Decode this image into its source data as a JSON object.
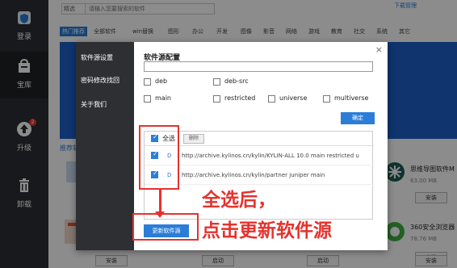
{
  "sidebar": {
    "items": [
      {
        "label": "登录",
        "icon": "shield-icon"
      },
      {
        "label": "宝库",
        "icon": "store-icon"
      },
      {
        "label": "升级",
        "icon": "upgrade-icon",
        "badge": "2"
      },
      {
        "label": "卸载",
        "icon": "trash-icon"
      }
    ]
  },
  "topbar": {
    "select_value": "精选",
    "search_placeholder": "请输入您要搜索的软件",
    "download_manager": "下载管理"
  },
  "categories": [
    "热门推荐",
    "全部软件",
    "win替换",
    "图形",
    "办公",
    "开发",
    "图像",
    "影音",
    "网络",
    "游戏",
    "教育",
    "社交",
    "系统",
    "其它"
  ],
  "background": {
    "recommend_title": "推荐软",
    "apps": [
      {
        "name": "思维导图软件M",
        "size": "63.00 MB",
        "button": "安装"
      },
      {
        "name": "360安全浏览器",
        "size": "78.76 MB",
        "button": "安装"
      }
    ],
    "bottom_buttons": [
      "安装",
      "启动",
      "启动",
      "安装"
    ]
  },
  "dialog": {
    "nav": [
      "软件源设置",
      "密码修改找回",
      "关于我们"
    ],
    "title": "软件源配置",
    "close": "×",
    "options": [
      {
        "label": "deb",
        "checked": false
      },
      {
        "label": "deb-src",
        "checked": false
      },
      {
        "label": "main",
        "checked": false
      },
      {
        "label": "restricted",
        "checked": false
      },
      {
        "label": "universe",
        "checked": false
      },
      {
        "label": "multiverse",
        "checked": false
      }
    ],
    "confirm": "确定",
    "select_all": "全选",
    "delete": "删除",
    "sources": [
      {
        "flag": "D",
        "url": "http://archive.kylinos.cn/kylin/KYLIN-ALL 10.0 main restricted u"
      },
      {
        "flag": "D",
        "url": "http://archive.kylinos.cn/kylin/partner juniper main"
      }
    ],
    "update": "更新软件源"
  },
  "annotation": {
    "line1": "全选后，",
    "line2": "点击更新软件源"
  },
  "colors": {
    "accent": "#2b7dd8",
    "highlight": "#e5322d",
    "sidebar": "#2d2f33"
  }
}
